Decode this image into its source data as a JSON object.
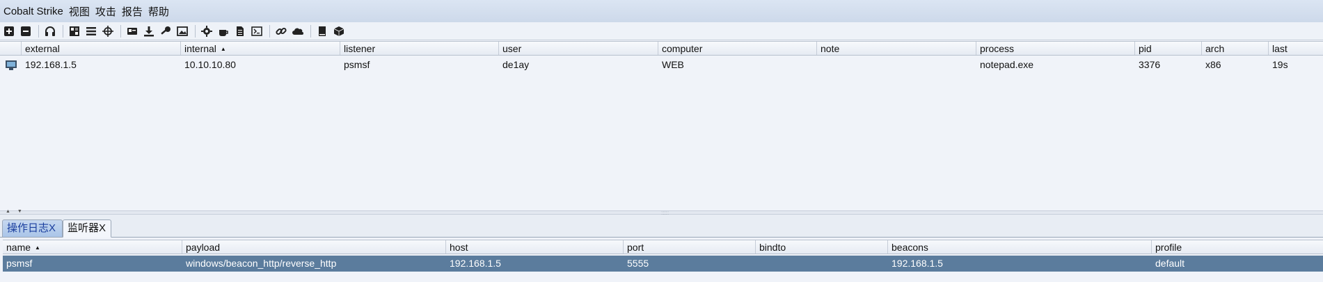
{
  "menu": [
    "Cobalt Strike",
    "视图",
    "攻击",
    "报告",
    "帮助"
  ],
  "toolbar": {
    "icons": [
      "new-connection-icon",
      "disconnect-icon",
      "headphones-icon",
      "pivot-graph-icon",
      "session-list-icon",
      "target-crosshair-icon",
      "credentials-card-icon",
      "download-icon",
      "key-icon",
      "screenshot-image-icon",
      "settings-gear-icon",
      "coffee-cup-icon",
      "document-icon",
      "console-icon",
      "link-icon",
      "cloud-icon",
      "book-icon",
      "package-box-icon"
    ]
  },
  "sessions": {
    "columns": [
      "external",
      "internal",
      "listener",
      "user",
      "computer",
      "note",
      "process",
      "pid",
      "arch",
      "last"
    ],
    "sorted_column": "internal",
    "rows": [
      {
        "external": "192.168.1.5",
        "internal": "10.10.10.80",
        "listener": "psmsf",
        "user": "de1ay",
        "computer": "WEB",
        "note": "",
        "process": "notepad.exe",
        "pid": "3376",
        "arch": "x86",
        "last": "19s"
      }
    ]
  },
  "tabs": [
    {
      "label": "操作日志X",
      "active": false
    },
    {
      "label": "监听器X",
      "active": true
    }
  ],
  "listeners": {
    "columns": [
      "name",
      "payload",
      "host",
      "port",
      "bindto",
      "beacons",
      "profile"
    ],
    "sorted_column": "name",
    "rows": [
      {
        "name": "psmsf",
        "payload": "windows/beacon_http/reverse_http",
        "host": "192.168.1.5",
        "port": "5555",
        "bindto": "",
        "beacons": "192.168.1.5",
        "profile": "default"
      }
    ]
  },
  "colors": {
    "selected_row": "#5b7c9d",
    "inactive_tab": "#aac5e8",
    "menubar": "#cdd9ea"
  }
}
